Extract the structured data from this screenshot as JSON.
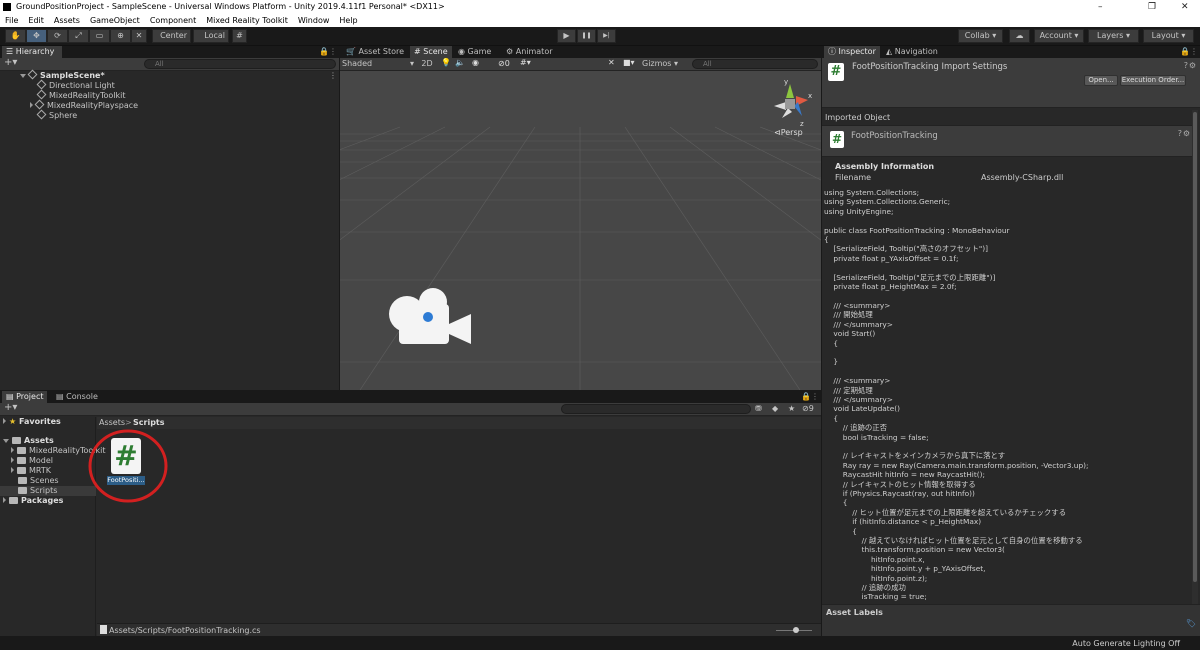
{
  "window": {
    "title": "GroundPositionProject - SampleScene - Universal Windows Platform - Unity 2019.4.11f1 Personal* <DX11>",
    "minimize": "–",
    "maximize": "❐",
    "close": "✕"
  },
  "menu": [
    "File",
    "Edit",
    "Assets",
    "GameObject",
    "Component",
    "Mixed Reality Toolkit",
    "Window",
    "Help"
  ],
  "toolbar": {
    "center": "Center",
    "local": "Local",
    "collab": "Collab ▾",
    "cloud": "☁",
    "account": "Account ▾",
    "layers": "Layers ▾",
    "layout": "Layout ▾",
    "play": "▶",
    "pause": "❚❚",
    "step": "▶|"
  },
  "hierarchy": {
    "tab": "Hierarchy",
    "search_placeholder": "All",
    "scene": "SampleScene*",
    "items": [
      "Directional Light",
      "MixedRealityToolkit",
      "MixedRealityPlayspace",
      "Sphere"
    ]
  },
  "center_tabs": {
    "asset_store": "Asset Store",
    "scene": "Scene",
    "game": "Game",
    "animator": "Animator"
  },
  "scene_bar": {
    "shading": "Shaded",
    "mode2d": "2D",
    "fx": "◉",
    "gizmos": "Gizmos",
    "hidden_count": "0",
    "search_placeholder": "All"
  },
  "scene_view": {
    "persp": "Persp",
    "gizmo_x": "x",
    "gizmo_y": "y",
    "gizmo_z": "z"
  },
  "project": {
    "tab": "Project",
    "console_tab": "Console",
    "favorites": "Favorites",
    "assets": "Assets",
    "folders": [
      "MixedRealityToolkit",
      "Model",
      "MRTK",
      "Scenes",
      "Scripts"
    ],
    "packages": "Packages",
    "breadcrumb_root": "Assets",
    "breadcrumb_sep": ">",
    "breadcrumb_current": "Scripts",
    "asset_icon_glyph": "#",
    "asset_name": "FootPositi...",
    "footer_path": "Assets/Scripts/FootPositionTracking.cs",
    "badge_count": "9"
  },
  "inspector": {
    "tab": "Inspector",
    "nav_tab": "Navigation",
    "import_title": "FootPositionTracking Import Settings",
    "open_btn": "Open...",
    "exec_btn": "Execution Order...",
    "imported_object": "Imported Object",
    "object_name": "FootPositionTracking",
    "assembly_info": "Assembly Information",
    "filename_label": "Filename",
    "filename_value": "Assembly-CSharp.dll",
    "asset_labels": "Asset Labels",
    "glyph": "#"
  },
  "code": "using System.Collections;\nusing System.Collections.Generic;\nusing UnityEngine;\n\npublic class FootPositionTracking : MonoBehaviour\n{\n    [SerializeField, Tooltip(\"高さのオフセット\")]\n    private float p_YAxisOffset = 0.1f;\n\n    [SerializeField, Tooltip(\"足元までの上限距離\")]\n    private float p_HeightMax = 2.0f;\n\n    /// <summary>\n    /// 開始処理\n    /// </summary>\n    void Start()\n    {\n\n    }\n\n    /// <summary>\n    /// 定期処理\n    /// </summary>\n    void LateUpdate()\n    {\n        // 追跡の正否\n        bool isTracking = false;\n\n        // レイキャストをメインカメラから真下に落とす\n        Ray ray = new Ray(Camera.main.transform.position, -Vector3.up);\n        RaycastHit hitInfo = new RaycastHit();\n        // レイキャストのヒット情報を取得する\n        if (Physics.Raycast(ray, out hitInfo))\n        {\n            // ヒット位置が足元までの上限距離を超えているかチェックする\n            if (hitInfo.distance < p_HeightMax)\n            {\n                // 越えていなければヒット位置を足元として自身の位置を移動する\n                this.transform.position = new Vector3(\n                    hitInfo.point.x,\n                    hitInfo.point.y + p_YAxisOffset,\n                    hitInfo.point.z);\n                // 追跡の成功\n                isTracking = true;",
  "status": {
    "lighting": "Auto Generate Lighting Off"
  },
  "colors": {
    "accent_highlight": "#d22020",
    "selection": "#2c5d87",
    "panel": "#282828",
    "scene_bg": "#474747"
  }
}
